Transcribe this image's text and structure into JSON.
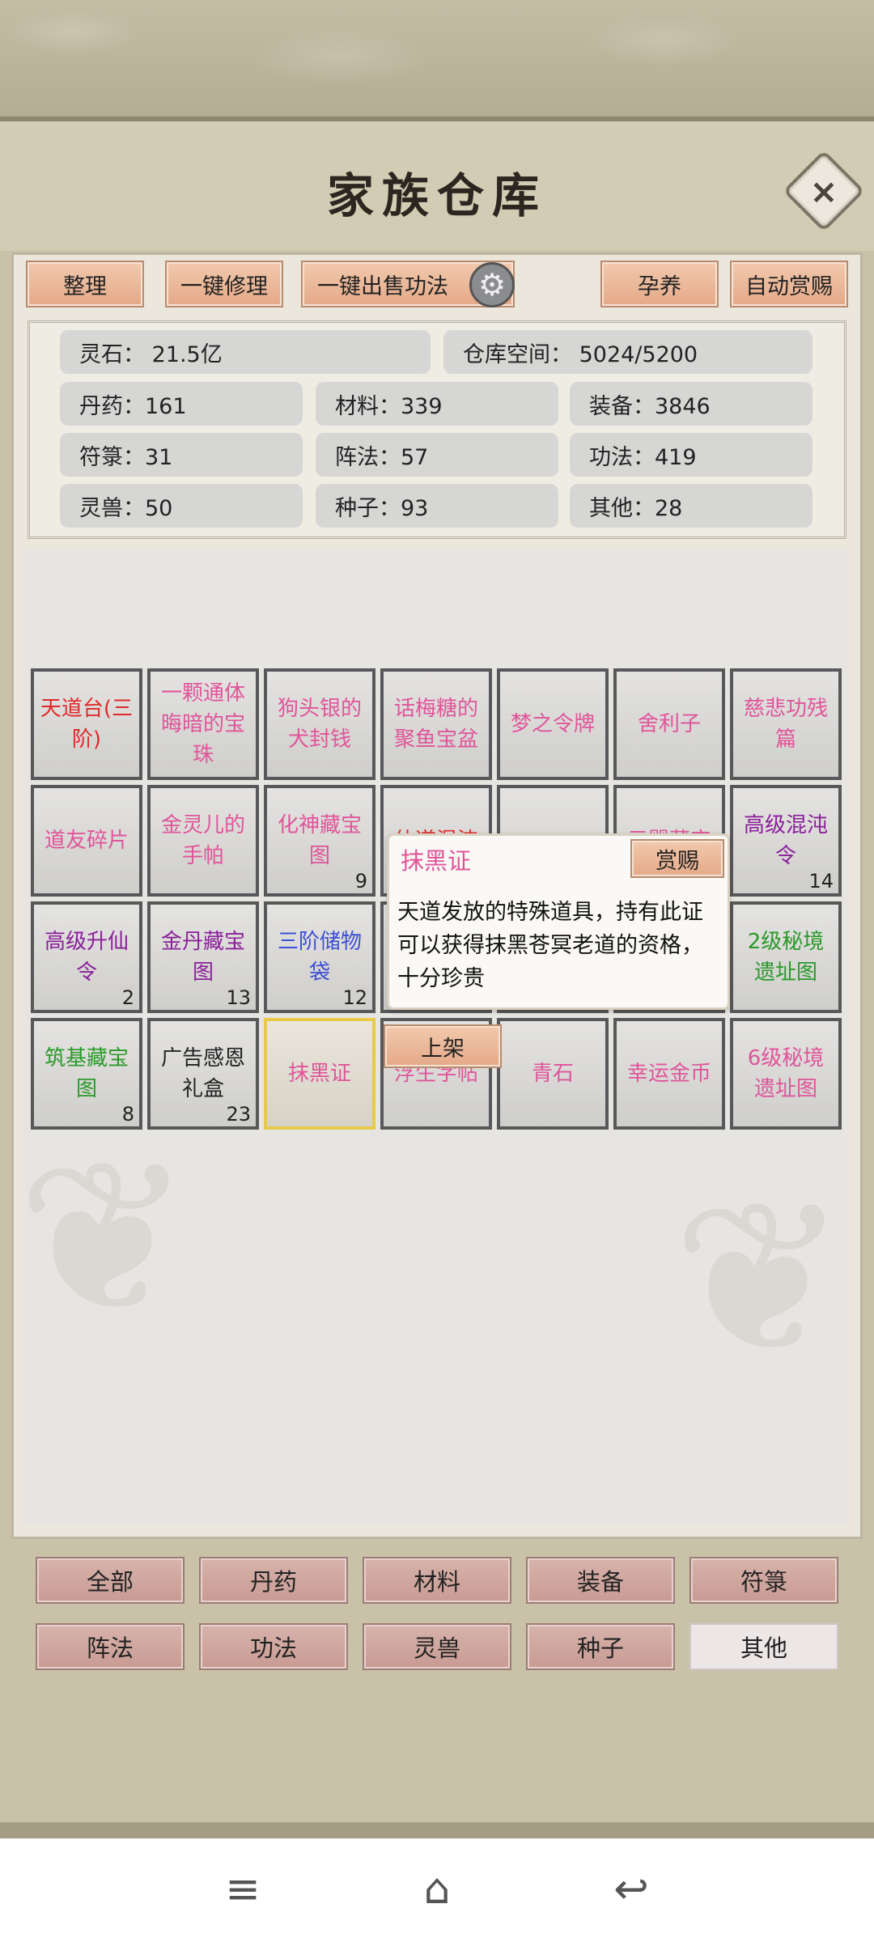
{
  "header": {
    "title": "家族仓库",
    "close_icon": "×"
  },
  "toolbar": {
    "sort": "整理",
    "repair_all": "一键修理",
    "sell_all_skills": "一键出售功法",
    "settings_icon": "⚙",
    "nurture": "孕养",
    "auto_reward": "自动赏赐"
  },
  "stats": {
    "spirit_stone": "灵石：  21.5亿",
    "storage_space": "仓库空间：    5024/5200",
    "pills": "丹药：161",
    "materials": "材料：339",
    "equipment": "装备：3846",
    "talismans": "符箓：31",
    "formations": "阵法：57",
    "skills": "功法：419",
    "spirit_beasts": "灵兽：50",
    "seeds": "种子：93",
    "others": "其他：28"
  },
  "items": [
    {
      "name": "天道台(三阶)",
      "color": "#e02a2a",
      "count": ""
    },
    {
      "name": "一颗通体晦暗的宝珠",
      "color": "#e0559a",
      "count": ""
    },
    {
      "name": "狗头银的犬封钱",
      "color": "#e0559a",
      "count": ""
    },
    {
      "name": "话梅糖的聚鱼宝盆",
      "color": "#e0559a",
      "count": ""
    },
    {
      "name": "梦之令牌",
      "color": "#e0559a",
      "count": ""
    },
    {
      "name": "舍利子",
      "color": "#e0559a",
      "count": ""
    },
    {
      "name": "慈悲功残篇",
      "color": "#e0559a",
      "count": ""
    },
    {
      "name": "道友碎片",
      "color": "#e0559a",
      "count": ""
    },
    {
      "name": "金灵儿的手帕",
      "color": "#e0559a",
      "count": ""
    },
    {
      "name": "化神藏宝图",
      "color": "#e0559a",
      "count": "9"
    },
    {
      "name": "仙道混沌",
      "color": "#e02a2a",
      "count": ""
    },
    {
      "name": "",
      "color": "#e0559a",
      "count": ""
    },
    {
      "name": "元婴藏宝",
      "color": "#e0559a",
      "count": ""
    },
    {
      "name": "高级混沌令",
      "color": "#8a1f9a",
      "count": "14"
    },
    {
      "name": "高级升仙令",
      "color": "#8a1f9a",
      "count": "2"
    },
    {
      "name": "金丹藏宝图",
      "color": "#8a1f9a",
      "count": "13"
    },
    {
      "name": "三阶储物袋",
      "color": "#3c4fd6",
      "count": "12"
    },
    {
      "name": "",
      "color": "#e0559a",
      "count": ""
    },
    {
      "name": "",
      "color": "#e0559a",
      "count": ""
    },
    {
      "name": "",
      "color": "#e0559a",
      "count": ""
    },
    {
      "name": "2级秘境遗址图",
      "color": "#2a9a2a",
      "count": ""
    },
    {
      "name": "筑基藏宝图",
      "color": "#2a9a2a",
      "count": "8"
    },
    {
      "name": "广告感恩礼盒",
      "color": "#222222",
      "count": "23"
    },
    {
      "name": "抹黑证",
      "color": "#e0559a",
      "count": ""
    },
    {
      "name": "浮生字帖",
      "color": "#e0559a",
      "count": ""
    },
    {
      "name": "青石",
      "color": "#e0559a",
      "count": ""
    },
    {
      "name": "幸运金币",
      "color": "#e0559a",
      "count": ""
    },
    {
      "name": "6级秘境遗址图",
      "color": "#e0559a",
      "count": ""
    }
  ],
  "tooltip": {
    "title": "抹黑证",
    "reward_button": "赏赐",
    "description": "天道发放的特殊道具，持有此证可以获得抹黑苍冥老道的资格，十分珍贵",
    "shelf_button": "上架"
  },
  "filters": [
    "全部",
    "丹药",
    "材料",
    "装备",
    "符箓",
    "阵法",
    "功法",
    "灵兽",
    "种子",
    "其他"
  ],
  "active_filter": "其他",
  "navbar": {
    "menu_icon": "≡",
    "home_icon": "⌂",
    "back_icon": "↩"
  }
}
